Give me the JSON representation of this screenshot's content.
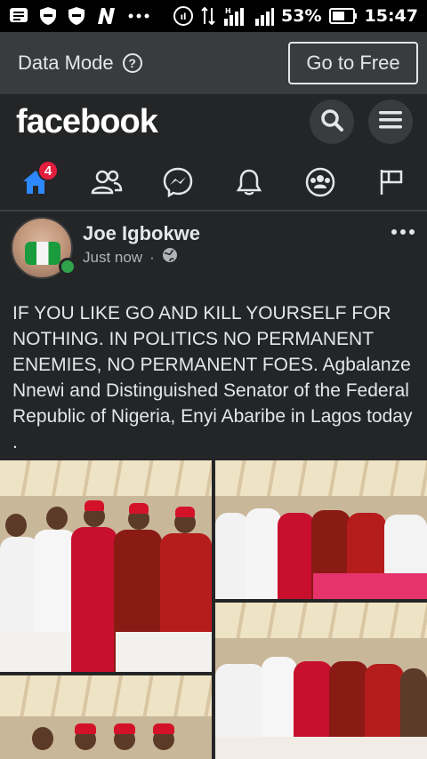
{
  "status_bar": {
    "icons": [
      "message-icon",
      "shield-icon",
      "shield-icon",
      "n-icon",
      "more-dots-icon",
      "hotspot-icon",
      "data-arrows-icon",
      "signal-h-icon",
      "signal-icon"
    ],
    "battery_percent": "53%",
    "time": "15:47"
  },
  "data_mode": {
    "label": "Data Mode",
    "help_icon": "?",
    "button_label": "Go to Free"
  },
  "header": {
    "logo": "facebook",
    "search_icon": "search-icon",
    "menu_icon": "menu-icon"
  },
  "nav": {
    "items": [
      {
        "name": "home",
        "icon": "home-icon",
        "badge": "4",
        "active": true
      },
      {
        "name": "friends",
        "icon": "friends-icon"
      },
      {
        "name": "messenger",
        "icon": "messenger-icon"
      },
      {
        "name": "notifications",
        "icon": "bell-icon"
      },
      {
        "name": "groups",
        "icon": "groups-icon"
      },
      {
        "name": "pages",
        "icon": "flag-icon"
      }
    ],
    "active_color": "#2d88ff"
  },
  "post": {
    "author": "Joe Igbokwe",
    "time": "Just now",
    "separator": "·",
    "audience_icon": "globe-icon",
    "text": "IF YOU LIKE GO AND KILL YOURSELF FOR NOTHING. IN POLITICS NO PERMANENT ENEMIES, NO PERMANENT FOES. Agbalanze Nnewi and Distinguished Senator of the Federal Republic of Nigeria, Enyi Abaribe in Lagos today ."
  },
  "colors": {
    "background": "#242526",
    "text": "#e4e6eb",
    "muted": "#b0b3b8",
    "badge": "#e41e3f",
    "online": "#31a24c"
  }
}
